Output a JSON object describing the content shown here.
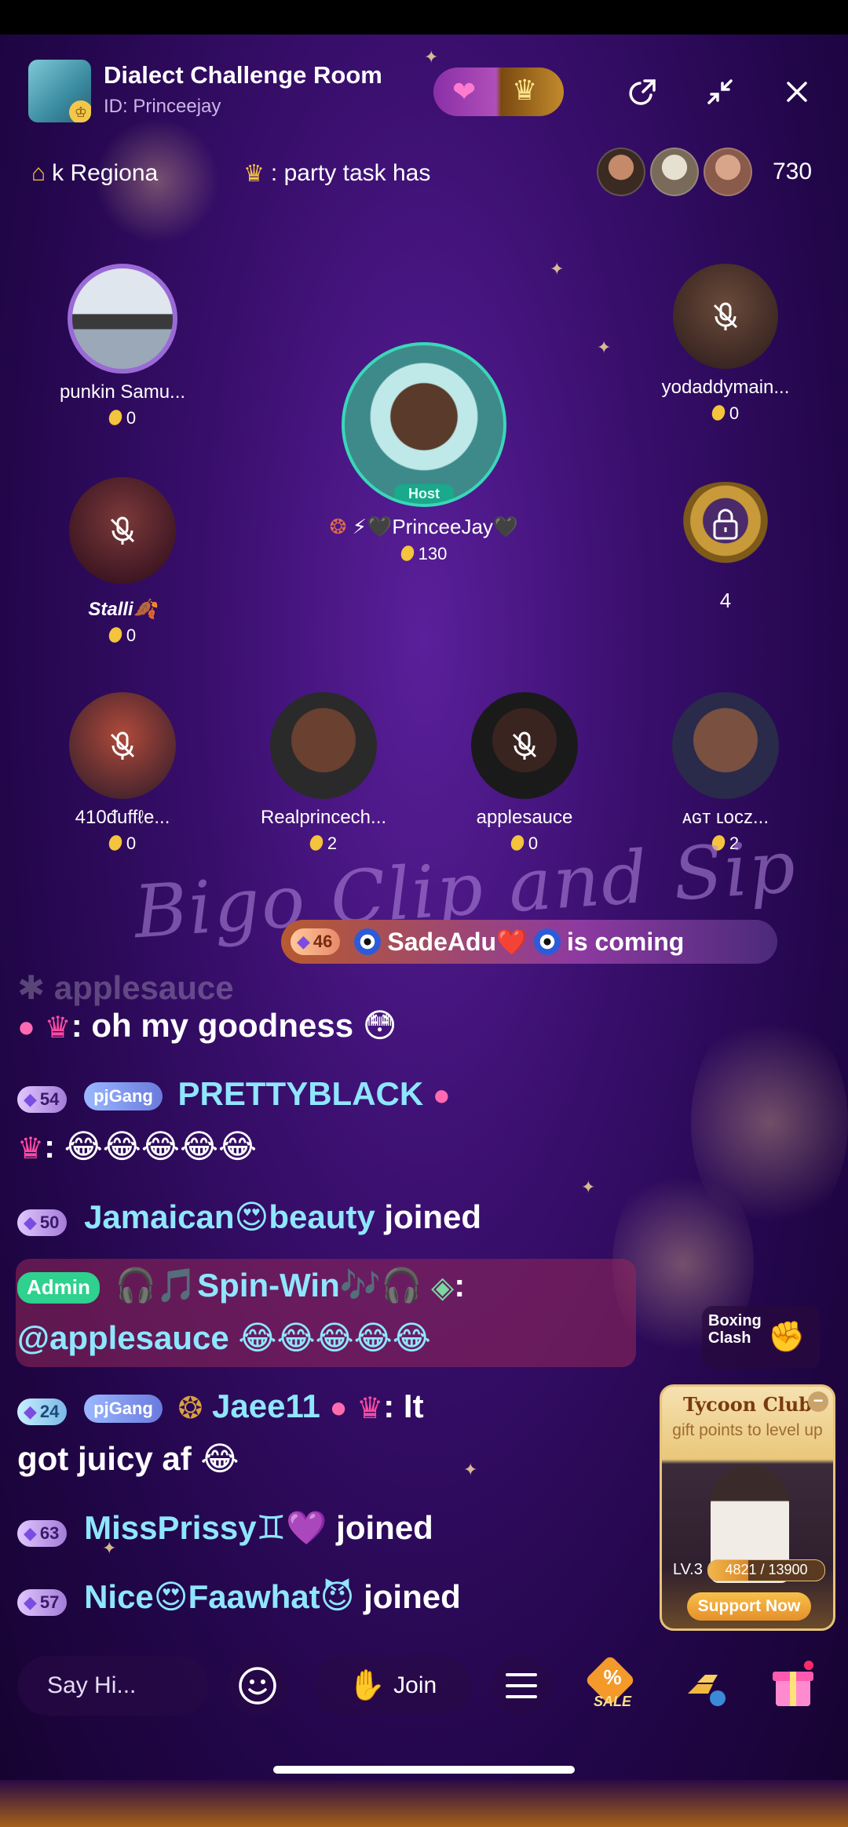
{
  "header": {
    "room_title": "Dialect Challenge Room",
    "room_id": "ID: Princeejay"
  },
  "ticker": {
    "left_text": "k  Regiona",
    "right_text": ": party task has",
    "viewer_count": "730"
  },
  "seats": {
    "punkin": {
      "name": "punkin Samu...",
      "coins": "0"
    },
    "yodaddy": {
      "name": "yodaddymain...",
      "coins": "0"
    },
    "host": {
      "name": "⚡🖤PrinceeJay🖤",
      "coins": "130",
      "tag": "Host"
    },
    "stalli": {
      "name": "Stalli🍂",
      "coins": "0"
    },
    "locked_seat_number": "4",
    "duffle": {
      "name": "410ᵭuffℓe...",
      "coins": "0"
    },
    "realprince": {
      "name": "Realprincech...",
      "coins": "2"
    },
    "applesauce": {
      "name": "applesauce",
      "coins": "0"
    },
    "agt": {
      "name": "ᴀɢᴛ ʟᴏᴄᴢ...",
      "coins": "2"
    }
  },
  "banner": {
    "watermark": "Bigo Clip and Sip",
    "entrant_level": "46",
    "entrant_name": "SadeAdu❤️",
    "entrant_suffix": "is coming"
  },
  "chat": {
    "ghost_line": "✱ applesauce",
    "msg1_text": ": oh my goodness 😳",
    "msg2_level": "54",
    "msg2_gang": "pjGang",
    "msg2_name": "PRETTYBLACK",
    "msg2_text": ": 😂😂😂😂😂",
    "msg3_level": "50",
    "msg3_name": "Jamaican😍beauty",
    "msg3_joined": "joined",
    "msg4_admin": "Admin",
    "msg4_name": "🎧🎵Spin-Win🎶🎧",
    "msg4_text": "@applesauce 😂😂😂😂😂",
    "msg5_level": "24",
    "msg5_gang": "pjGang",
    "msg5_name": "Jaee11",
    "msg5_text_a": ": It",
    "msg5_text_b": "got juicy af 😂",
    "msg6_level": "63",
    "msg6_name": "MissPrissy♊💜",
    "msg6_joined": "joined",
    "msg7_level": "57",
    "msg7_name": "Nice😍Faawhat😈",
    "msg7_joined": "joined"
  },
  "widgets": {
    "boxing_label_1": "Boxing",
    "boxing_label_2": "Clash",
    "tycoon_title": "Tycoon Club",
    "tycoon_subtitle": "gift points to level up",
    "tycoon_level": "LV.3",
    "tycoon_progress_text": "4821 / 13900",
    "tycoon_progress_fraction": 0.347,
    "tycoon_button": "Support Now"
  },
  "bottom": {
    "say_hi": "Say Hi...",
    "join_label": "Join",
    "sale_label": "SALE",
    "sale_symbol": "%"
  },
  "colors": {
    "host_ring": "#39d7b8",
    "admin_badge": "#2ed18e",
    "name_cyan": "#8fe6ff"
  }
}
